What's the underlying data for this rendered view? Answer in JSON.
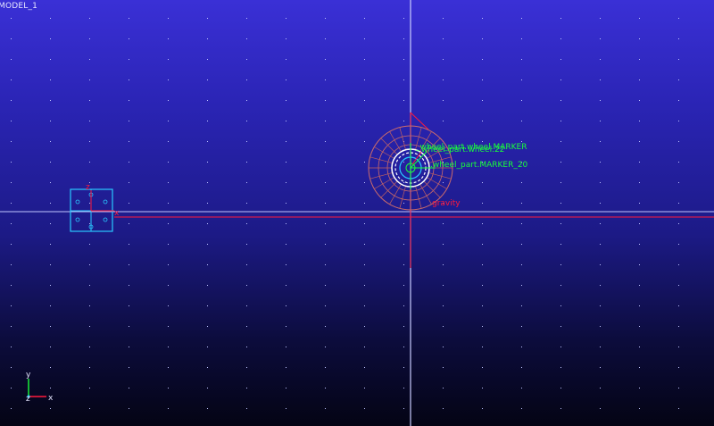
{
  "viewport": {
    "model_name": "MODEL_1"
  },
  "annotations": {
    "marker_label": ".wheel_part.MARKER_20",
    "overlap_label_a": "_wheel_part.wheel.MARKER",
    "overlap_label_b": "wheel_part.wheel.22",
    "gravity_label": "gravity"
  },
  "triad": {
    "y_label": "y",
    "z_label": "z",
    "x_label": "x"
  },
  "block_part": {
    "z_label": "z",
    "x_label": "x"
  },
  "colors": {
    "axis_white": "#cfd3ff",
    "gravity_red": "#ff1a3c",
    "label_green": "#19ff3a",
    "part_cyan": "#29c9ff",
    "wheel_outline": "#ffffff",
    "wheel_mesh": "#d06a6a"
  },
  "icons": {
    "view_triad": "triad-icon",
    "marker": "marker-icon",
    "gravity": "gravity-arrow-icon"
  }
}
